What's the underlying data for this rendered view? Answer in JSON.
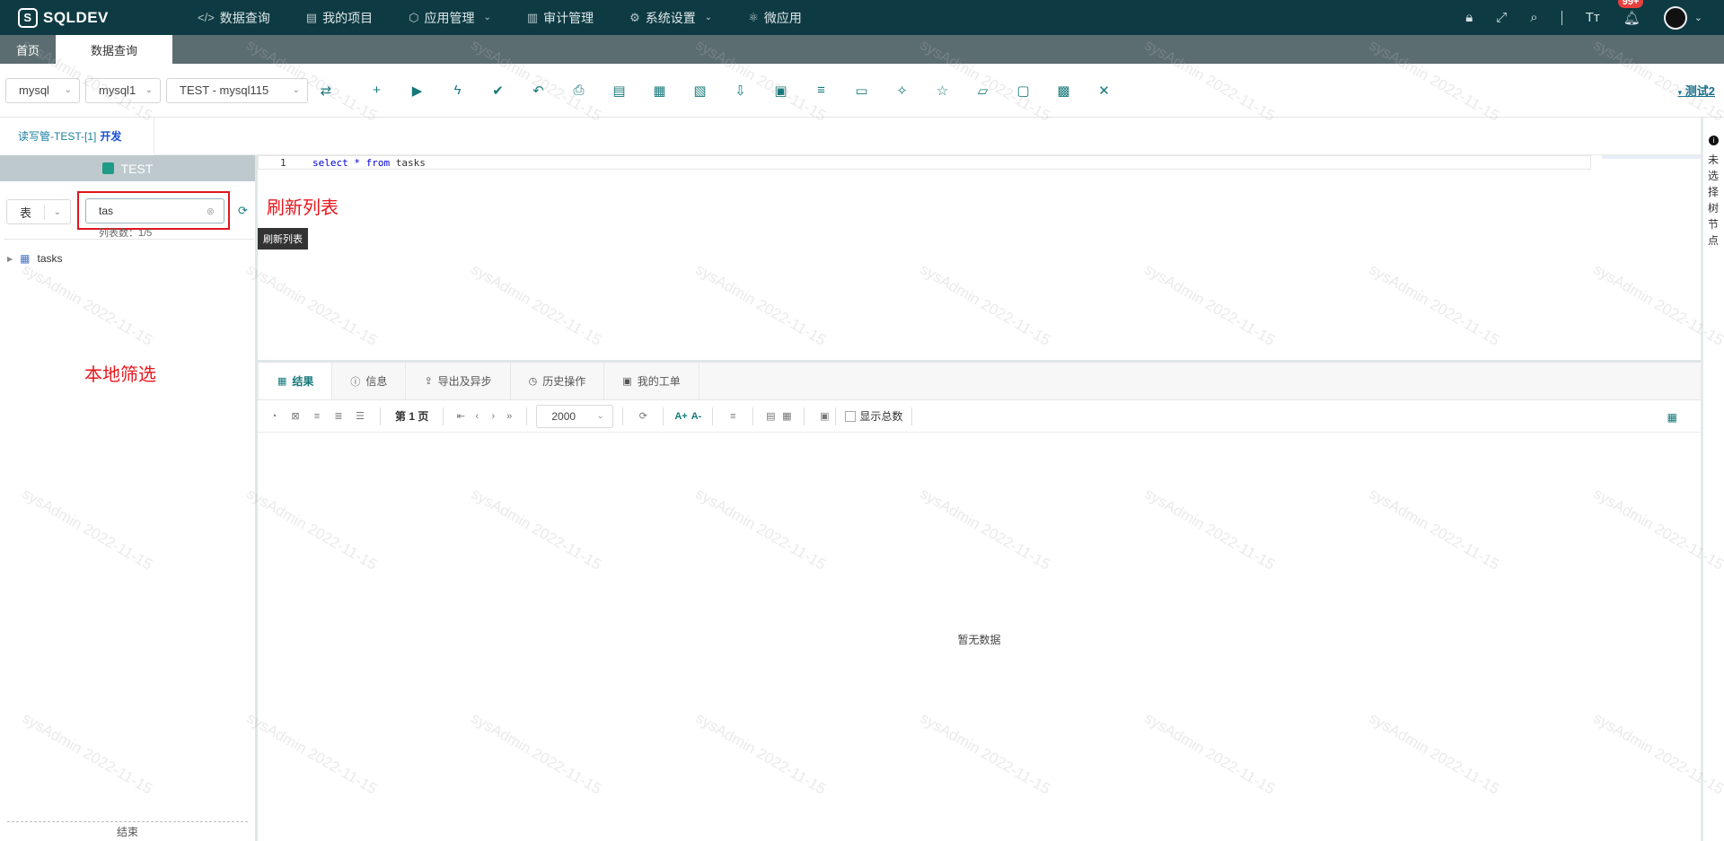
{
  "brand": {
    "name": "SQLDEV",
    "logo_glyph": "S"
  },
  "nav": {
    "items": [
      {
        "label": "数据查询",
        "icon": "code-icon"
      },
      {
        "label": "我的项目",
        "icon": "folder-icon"
      },
      {
        "label": "应用管理",
        "icon": "box-icon",
        "dropdown": true
      },
      {
        "label": "审计管理",
        "icon": "document-icon"
      },
      {
        "label": "系统设置",
        "icon": "gear-icon",
        "dropdown": true
      },
      {
        "label": "微应用",
        "icon": "atom-icon"
      }
    ],
    "notification_count": "99+"
  },
  "page_tabs": [
    {
      "label": "首页",
      "active": false
    },
    {
      "label": "数据查询",
      "active": true
    }
  ],
  "toolbar": {
    "db_type": "mysql",
    "instance": "mysql1",
    "connection": "TEST - mysql115",
    "user": "测试2"
  },
  "conn_tab": {
    "label": "读写管-TEST-[1]",
    "env": "开发"
  },
  "left_panel": {
    "db_name": "TEST",
    "object_kind": "表",
    "search_value": "tas",
    "count_text": "列表数：1/5",
    "tree_items": [
      "tasks"
    ],
    "end_text": "结束"
  },
  "annotations": {
    "refresh": "刷新列表",
    "local_filter": "本地筛选"
  },
  "editor": {
    "line_number": "1",
    "code": {
      "kw1": "select",
      "star": "*",
      "kw2": "from",
      "table": "tasks"
    },
    "tooltip": "刷新列表"
  },
  "results": {
    "tabs": [
      {
        "label": "结果",
        "icon": "grid-icon",
        "active": true
      },
      {
        "label": "信息",
        "icon": "info-icon",
        "active": false
      },
      {
        "label": "导出及异步",
        "icon": "export-icon",
        "active": false
      },
      {
        "label": "历史操作",
        "icon": "clock-icon",
        "active": false
      },
      {
        "label": "我的工单",
        "icon": "ticket-icon",
        "active": false
      }
    ],
    "page_label": "第 1 页",
    "page_size": "2000",
    "show_total_label": "显示总数",
    "font_up": "A+",
    "font_down": "A-",
    "empty_text": "暂无数据"
  },
  "right_rail": {
    "text": "未选择树节点"
  },
  "watermark": "sysAdmin 2022-11-15"
}
